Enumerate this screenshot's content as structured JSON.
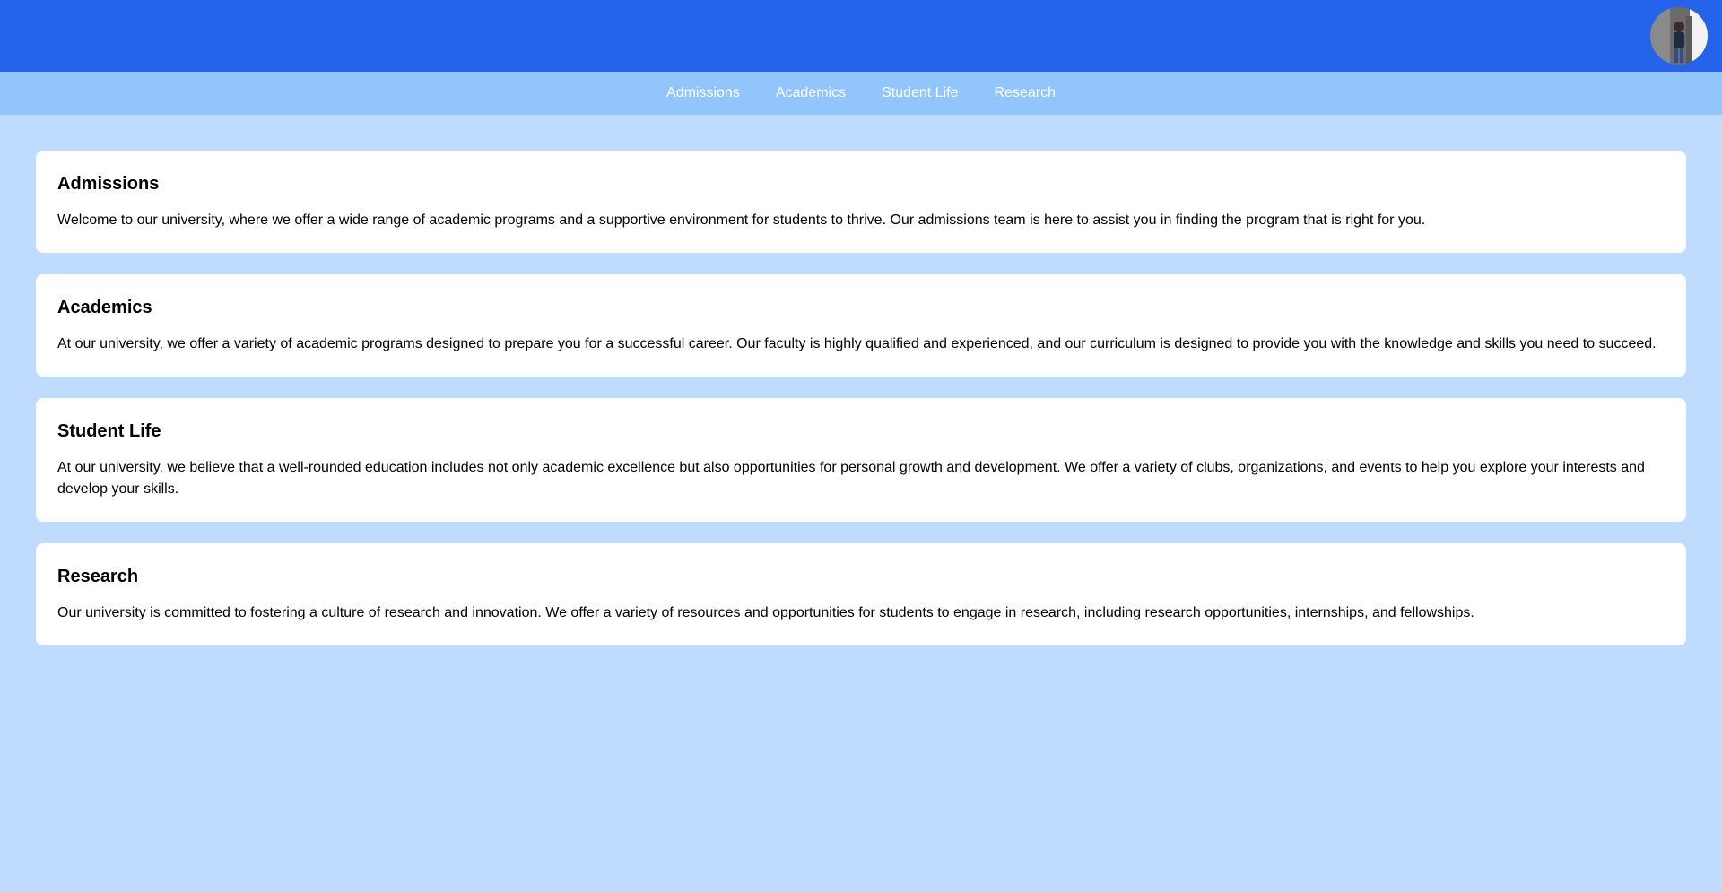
{
  "header": {
    "avatar_icon": "user-avatar-photo",
    "color": "#2563eb"
  },
  "nav": {
    "items": [
      {
        "label": "Admissions"
      },
      {
        "label": "Academics"
      },
      {
        "label": "Student Life"
      },
      {
        "label": "Research"
      }
    ],
    "color": "#93c5fd"
  },
  "sections": [
    {
      "title": "Admissions",
      "text": "Welcome to our university, where we offer a wide range of academic programs and a supportive environment for students to thrive. Our admissions team is here to assist you in finding the program that is right for you."
    },
    {
      "title": "Academics",
      "text": "At our university, we offer a variety of academic programs designed to prepare you for a successful career. Our faculty is highly qualified and experienced, and our curriculum is designed to provide you with the knowledge and skills you need to succeed."
    },
    {
      "title": "Student Life",
      "text": "At our university, we believe that a well-rounded education includes not only academic excellence but also opportunities for personal growth and development. We offer a variety of clubs, organizations, and events to help you explore your interests and develop your skills."
    },
    {
      "title": "Research",
      "text": "Our university is committed to fostering a culture of research and innovation. We offer a variety of resources and opportunities for students to engage in research, including research opportunities, internships, and fellowships."
    }
  ],
  "page_background": "#bfdbfe"
}
